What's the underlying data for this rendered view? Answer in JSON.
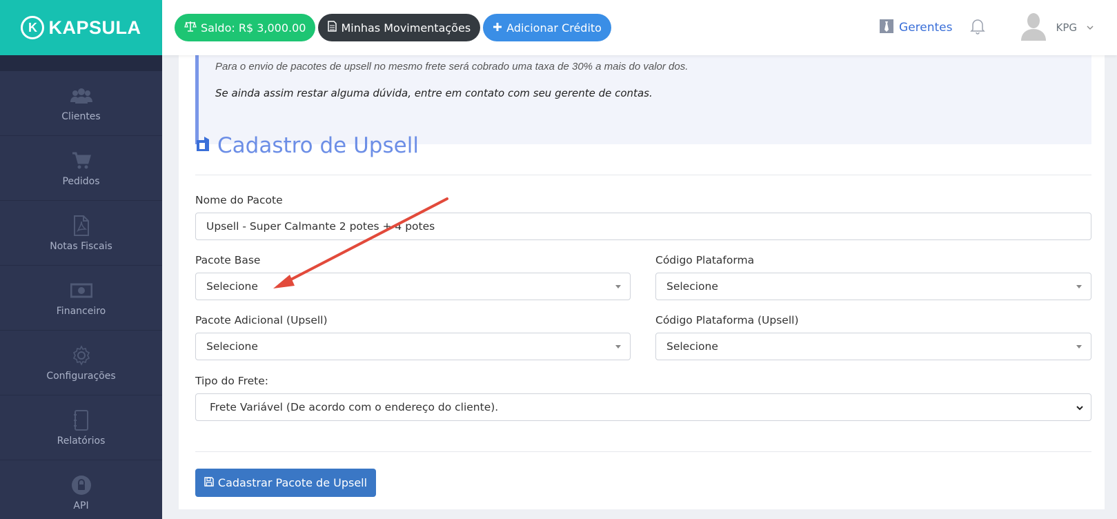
{
  "brand": {
    "name": "KAPSULA",
    "mark": "K"
  },
  "sidebar": {
    "items": [
      {
        "label": "Clientes",
        "icon": "users-icon"
      },
      {
        "label": "Pedidos",
        "icon": "cart-icon"
      },
      {
        "label": "Notas Fiscais",
        "icon": "pdf-file-icon"
      },
      {
        "label": "Financeiro",
        "icon": "money-icon"
      },
      {
        "label": "Configurações",
        "icon": "gear-icon"
      },
      {
        "label": "Relatórios",
        "icon": "notebook-icon"
      },
      {
        "label": "API",
        "icon": "lock-icon"
      }
    ]
  },
  "topbar": {
    "saldo": "Saldo: R$ 3,000.00",
    "movimentacoes": "Minhas Movimentações",
    "adicionar": "Adicionar Crédito",
    "gerentes": "Gerentes",
    "user": "KPG"
  },
  "notice": {
    "cut_line": "Para o envio de pacotes de upsell no mesmo frete será cobrado uma taxa de 30% a mais do valor dos.",
    "text": "Se ainda assim restar alguma dúvida, entre em contato com seu gerente de contas."
  },
  "form": {
    "title": "Cadastro de Upsell",
    "nome_label": "Nome do Pacote",
    "nome_value": "Upsell - Super Calmante 2 potes + 4 potes",
    "pacote_base_label": "Pacote Base",
    "pacote_base_value": "Selecione",
    "codigo_plataforma_label": "Código Plataforma",
    "codigo_plataforma_value": "Selecione",
    "pacote_adicional_label": "Pacote Adicional (Upsell)",
    "pacote_adicional_value": "Selecione",
    "codigo_plataforma_upsell_label": "Código Plataforma (Upsell)",
    "codigo_plataforma_upsell_value": "Selecione",
    "tipo_frete_label": "Tipo do Frete:",
    "tipo_frete_value": "Frete Variável (De acordo com o endereço do cliente).",
    "submit": "Cadastrar Pacote de Upsell"
  },
  "colors": {
    "sidebar": "#2d3551",
    "brand": "#17c1b1",
    "saldo": "#1dc573",
    "adicionar": "#3a8ee6",
    "submit": "#3a77c5",
    "annotation_arrow": "#e24a3b"
  }
}
